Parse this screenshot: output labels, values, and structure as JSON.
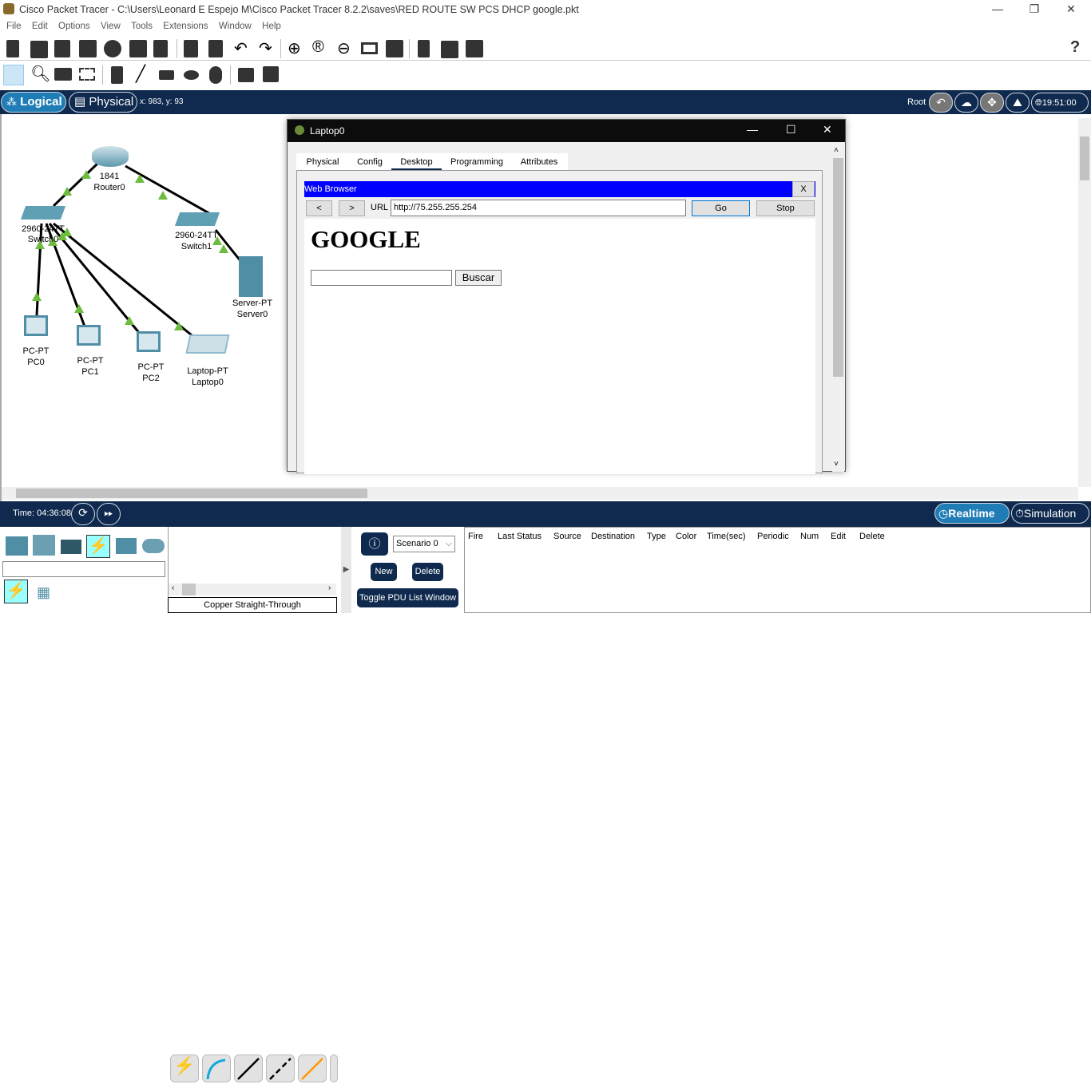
{
  "window": {
    "title": "Cisco Packet Tracer - C:\\Users\\Leonard E Espejo M\\Cisco Packet Tracer 8.2.2\\saves\\RED ROUTE SW PCS DHCP google.pkt",
    "minimize": "—",
    "restore": "❐",
    "close": "✕"
  },
  "menu": [
    "File",
    "Edit",
    "Options",
    "View",
    "Tools",
    "Extensions",
    "Window",
    "Help"
  ],
  "toolbar": {
    "help": "?"
  },
  "navbar": {
    "logical": "Logical",
    "physical": "Physical",
    "coords": "x: 983, y: 93",
    "root": "Root",
    "clock": "19:51:00"
  },
  "devices": [
    {
      "id": "router0",
      "model": "1841",
      "name": "Router0"
    },
    {
      "id": "switch0",
      "model": "2960-24TT",
      "name": "Switch0"
    },
    {
      "id": "switch1",
      "model": "2960-24TT",
      "name": "Switch1"
    },
    {
      "id": "server0",
      "model": "Server-PT",
      "name": "Server0"
    },
    {
      "id": "pc0",
      "model": "PC-PT",
      "name": "PC0"
    },
    {
      "id": "pc1",
      "model": "PC-PT",
      "name": "PC1"
    },
    {
      "id": "pc2",
      "model": "PC-PT",
      "name": "PC2"
    },
    {
      "id": "laptop0",
      "model": "Laptop-PT",
      "name": "Laptop0"
    }
  ],
  "dialog": {
    "title": "Laptop0",
    "tabs": [
      "Physical",
      "Config",
      "Desktop",
      "Programming",
      "Attributes"
    ],
    "active_tab": "Desktop",
    "browser": {
      "title": "Web Browser",
      "close": "X",
      "back": "<",
      "forward": ">",
      "url_label": "URL",
      "url": "http://75.255.255.254",
      "go": "Go",
      "stop": "Stop",
      "page": {
        "heading": "GOOGLE",
        "search_value": "",
        "search_button": "Buscar"
      }
    }
  },
  "bottom": {
    "time": "Time: 04:36:08",
    "realtime": "Realtime",
    "simulation": "Simulation",
    "cable_name": "Copper Straight-Through",
    "scenario": "Scenario 0",
    "new": "New",
    "delete": "Delete",
    "toggle": "Toggle PDU List Window",
    "pdu_columns": [
      "Fire",
      "Last Status",
      "Source",
      "Destination",
      "Type",
      "Color",
      "Time(sec)",
      "Periodic",
      "Num",
      "Edit",
      "Delete"
    ]
  },
  "colors": {
    "navy": "#0f2a4e",
    "link_up": "#6dbb3f",
    "browser_bar": "#0000ff",
    "active_tab": "#0f2a4e"
  }
}
